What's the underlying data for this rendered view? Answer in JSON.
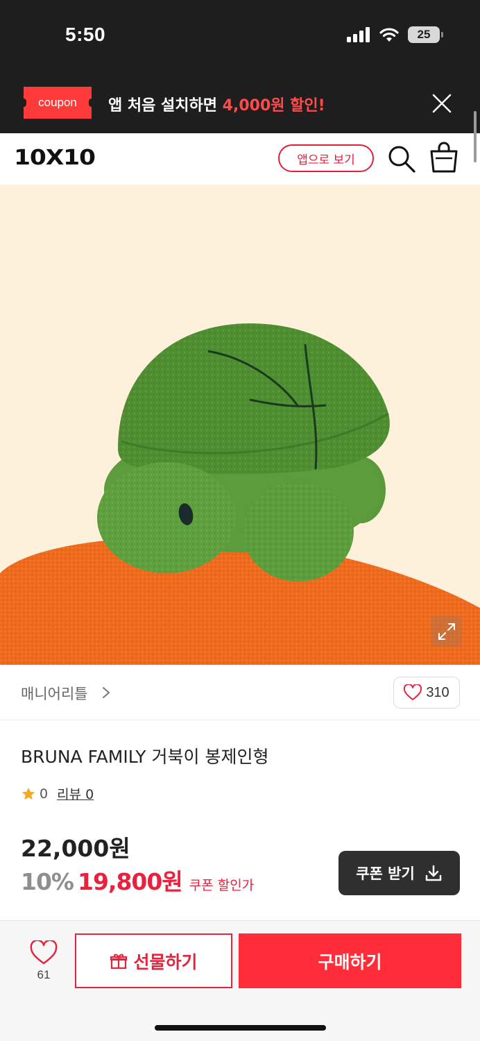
{
  "status_bar": {
    "time": "5:50",
    "battery": "25"
  },
  "coupon_banner": {
    "tag": "coupon",
    "text_prefix": "앱 처음 설치하면 ",
    "text_highlight": "4,000원 할인!"
  },
  "header": {
    "logo": "10X10",
    "app_button": "앱으로 보기"
  },
  "brand": {
    "name": "매니어리틀",
    "like_count": "310"
  },
  "product": {
    "title": "BRUNA FAMILY 거북이 봉제인형",
    "rating": "0",
    "review_label": "리뷰 0",
    "original_price": "22,000원",
    "discount_rate": "10%",
    "sale_price": "19,800원",
    "sale_note": "쿠폰 할인가",
    "coupon_button": "쿠폰 받기"
  },
  "bottom_bar": {
    "wish_count": "61",
    "gift_button": "선물하기",
    "buy_button": "구매하기"
  },
  "colors": {
    "accent": "#e8213d",
    "buy": "#ff2d3a",
    "banner_bg": "#1e1e1e",
    "image_bg": "#fdf1dc"
  }
}
